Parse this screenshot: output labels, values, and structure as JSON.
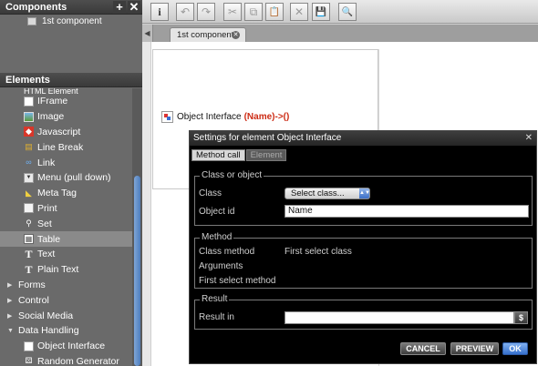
{
  "left_panel": {
    "components_title": "Components",
    "add_label": "+",
    "close_label": "✕",
    "components": [
      {
        "label": "1st component"
      }
    ],
    "elements_title": "Elements",
    "elements_partial": "HTML Element",
    "elements": [
      {
        "label": "IFrame",
        "icon": "iframe-icon"
      },
      {
        "label": "Image",
        "icon": "image-icon"
      },
      {
        "label": "Javascript",
        "icon": "javascript-icon"
      },
      {
        "label": "Line Break",
        "icon": "line-break-icon"
      },
      {
        "label": "Link",
        "icon": "link-icon"
      },
      {
        "label": "Menu (pull down)",
        "icon": "menu-icon"
      },
      {
        "label": "Meta Tag",
        "icon": "meta-tag-icon"
      },
      {
        "label": "Print",
        "icon": "print-icon"
      },
      {
        "label": "Set",
        "icon": "set-icon"
      },
      {
        "label": "Table",
        "icon": "table-icon"
      },
      {
        "label": "Text",
        "icon": "text-icon"
      },
      {
        "label": "Plain Text",
        "icon": "plain-text-icon"
      }
    ],
    "categories": [
      {
        "label": "Forms",
        "expanded": false
      },
      {
        "label": "Control",
        "expanded": false
      },
      {
        "label": "Social Media",
        "expanded": false
      },
      {
        "label": "Data Handling",
        "expanded": true
      }
    ],
    "data_handling_items": [
      {
        "label": "Object Interface",
        "icon": "object-interface-icon"
      },
      {
        "label": "Random Generator",
        "icon": "random-generator-icon"
      }
    ]
  },
  "toolbar": {
    "info_label": "i",
    "undo_label": "↶",
    "redo_label": "↷",
    "cut_label": "✂",
    "copy_label": "⧉",
    "paste_label": "📋",
    "delete_label": "✕",
    "save_label": "💾",
    "preview_label": "🔍"
  },
  "tabs": {
    "scroll_label": "◀",
    "items": [
      {
        "label": "1st component",
        "close": "✕"
      }
    ]
  },
  "canvas": {
    "element_label": "Object Interface",
    "element_call": "(Name)->()"
  },
  "dialog": {
    "title": "Settings for element Object Interface",
    "close": "✕",
    "tabs": [
      {
        "label": "Method call",
        "active": true
      },
      {
        "label": "Element",
        "active": false
      }
    ],
    "class_group": {
      "title": "Class or object",
      "class_label": "Class",
      "class_select_value": "Select class...",
      "object_id_label": "Object id",
      "object_id_value": "Name"
    },
    "method_group": {
      "title": "Method",
      "class_method_label": "Class method",
      "class_method_value": "First select class",
      "arguments_label": "Arguments",
      "first_select_method_label": "First select method"
    },
    "result_group": {
      "title": "Result",
      "result_in_label": "Result in",
      "result_in_value": "",
      "variable_button": "$"
    },
    "buttons": {
      "cancel": "CANCEL",
      "preview": "PREVIEW",
      "ok": "OK"
    }
  },
  "colors": {
    "accent_blue": "#3670cc",
    "call_red": "#cc2b14",
    "panel_gray": "#6a6a6a"
  }
}
